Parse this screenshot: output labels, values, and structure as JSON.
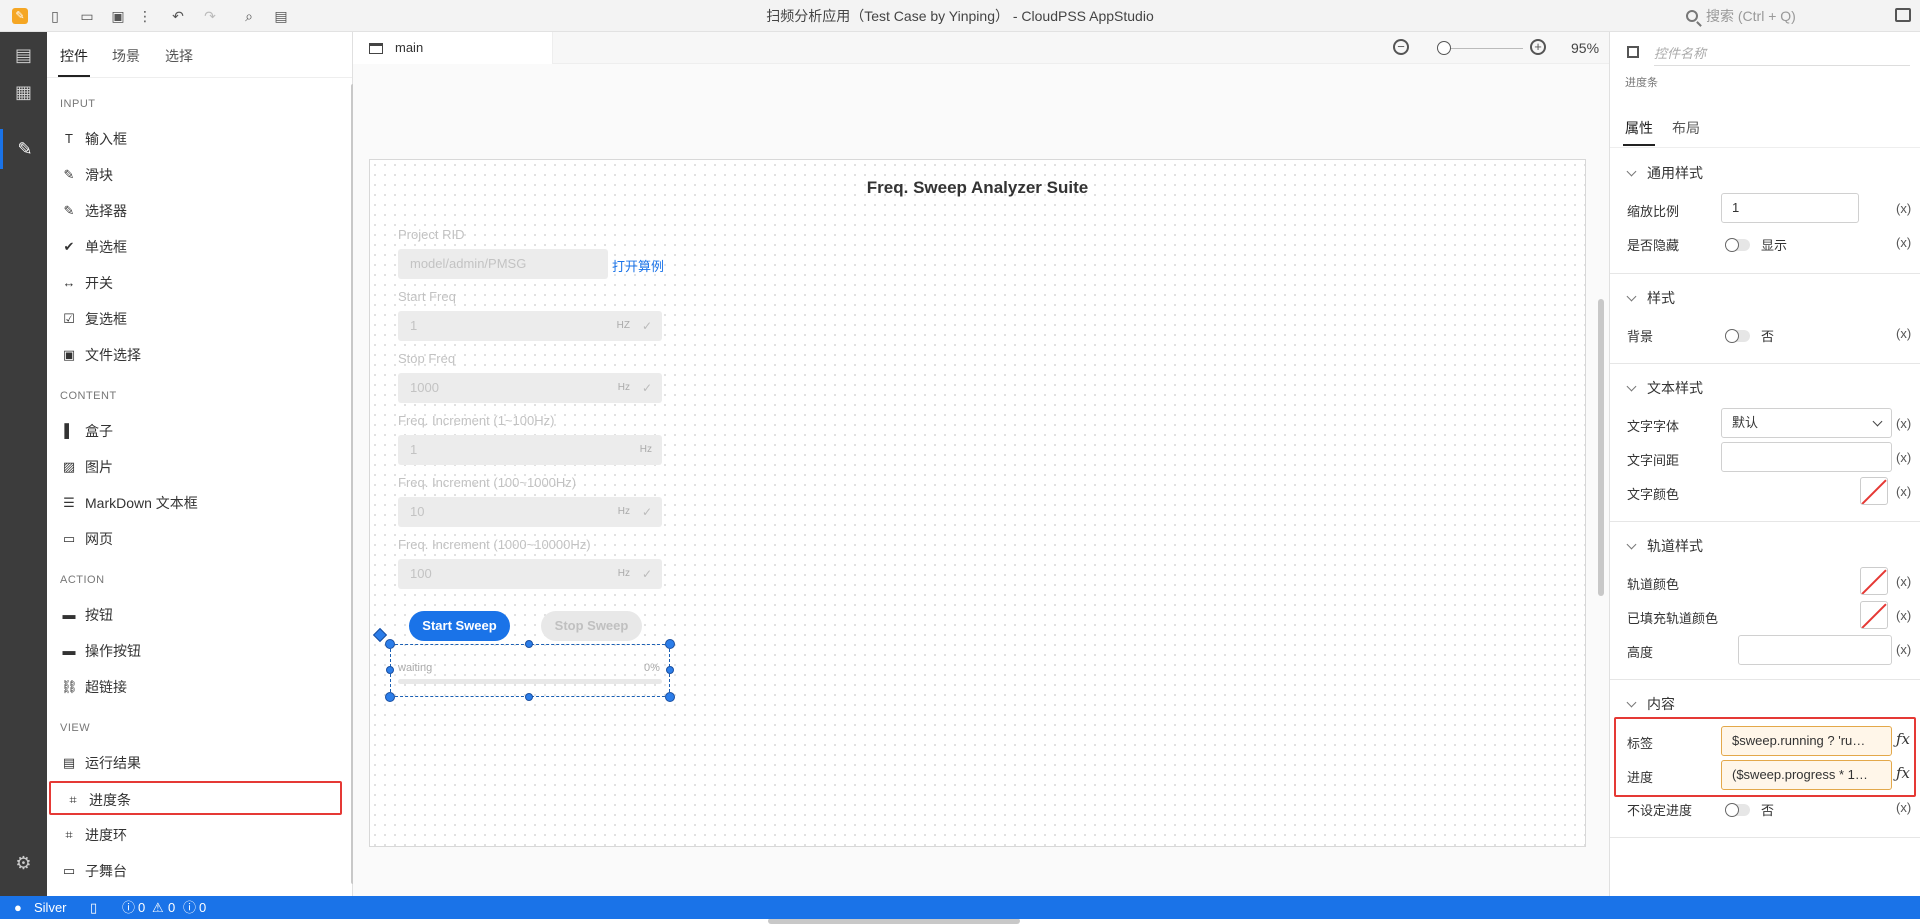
{
  "app": {
    "title": "扫频分析应用（Test Case by Yinping） - CloudPSS AppStudio",
    "search_placeholder": "搜索 (Ctrl + Q)"
  },
  "left_panel": {
    "tabs": [
      "控件",
      "场景",
      "选择"
    ],
    "sections": {
      "input": "INPUT",
      "content": "CONTENT",
      "action": "ACTION",
      "view": "VIEW"
    },
    "input_items": [
      {
        "label": "输入框",
        "icon": "text-input-icon"
      },
      {
        "label": "滑块",
        "icon": "slider-icon"
      },
      {
        "label": "选择器",
        "icon": "select-icon"
      },
      {
        "label": "单选框",
        "icon": "radio-icon"
      },
      {
        "label": "开关",
        "icon": "switch-icon"
      },
      {
        "label": "复选框",
        "icon": "checkbox-icon"
      },
      {
        "label": "文件选择",
        "icon": "file-select-icon"
      }
    ],
    "content_items": [
      {
        "label": "盒子",
        "icon": "box-icon"
      },
      {
        "label": "图片",
        "icon": "image-icon"
      },
      {
        "label": "MarkDown 文本框",
        "icon": "markdown-icon"
      },
      {
        "label": "网页",
        "icon": "webpage-icon"
      }
    ],
    "action_items": [
      {
        "label": "按钮",
        "icon": "button-icon"
      },
      {
        "label": "操作按钮",
        "icon": "action-button-icon"
      },
      {
        "label": "超链接",
        "icon": "link-icon"
      }
    ],
    "view_items": [
      {
        "label": "运行结果",
        "icon": "result-icon"
      },
      {
        "label": "进度条",
        "icon": "progress-bar-icon"
      },
      {
        "label": "进度环",
        "icon": "progress-ring-icon"
      },
      {
        "label": "子舞台",
        "icon": "sub-stage-icon"
      }
    ]
  },
  "editor": {
    "tab_label": "main",
    "zoom_label": "95%",
    "stage": {
      "title": "Freq. Sweep Analyzer Suite",
      "project_label": "Project RID",
      "project_value": "model/admin/PMSG",
      "open_link": "打开算例",
      "fields": [
        {
          "label": "Start Freq",
          "value": "1",
          "unit": "HZ",
          "check": true
        },
        {
          "label": "Stop Freq",
          "value": "1000",
          "unit": "Hz",
          "check": true
        },
        {
          "label": "Freq. Increment (1~100Hz)",
          "value": "1",
          "unit": "Hz",
          "check": false
        },
        {
          "label": "Freq. Increment (100~1000Hz)",
          "value": "10",
          "unit": "Hz",
          "check": true
        },
        {
          "label": "Freq. Increment (1000~10000Hz)",
          "value": "100",
          "unit": "Hz",
          "check": true
        }
      ],
      "start_button": "Start Sweep",
      "stop_button": "Stop Sweep",
      "progress_label": "waiting",
      "progress_pct": "0%",
      "progress_value": 0
    }
  },
  "right_panel": {
    "name_placeholder": "控件名称",
    "type": "进度条",
    "tabs": [
      "属性",
      "布局"
    ],
    "groups": {
      "general": "通用样式",
      "style": "样式",
      "text_style": "文本样式",
      "track_style": "轨道样式",
      "content": "内容"
    },
    "scale_label": "缩放比例",
    "scale_value": "1",
    "hidden_label": "是否隐藏",
    "hidden_value": "显示",
    "bg_label": "背景",
    "bg_value": "否",
    "font_label": "文字字体",
    "font_value": "默认",
    "spacing_label": "文字间距",
    "color_label": "文字颜色",
    "track_color_label": "轨道颜色",
    "filled_track_label": "已填充轨道颜色",
    "height_label": "高度",
    "tag_label": "标签",
    "tag_value": "$sweep.running ? 'ru…",
    "progress_label": "进度",
    "progress_value": "($sweep.progress * 1…",
    "indeterminate_label": "不设定进度",
    "indeterminate_value": "否",
    "x_marker": "(x)"
  },
  "status": {
    "user": "Silver",
    "errors": "0",
    "warnings": "0",
    "infos": "0"
  },
  "colors": {
    "accent": "#1a73e8",
    "highlight": "#e53935",
    "activity_bg": "#3c3c3c"
  }
}
